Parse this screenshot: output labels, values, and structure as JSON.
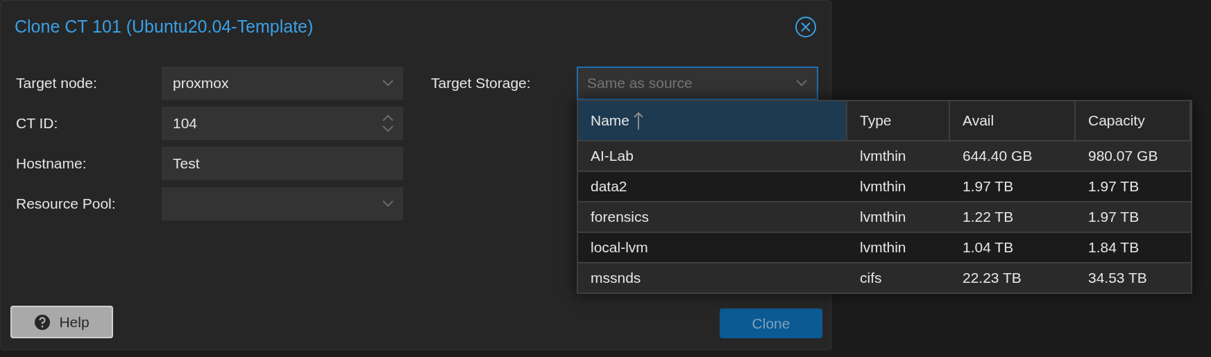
{
  "dialog": {
    "title": "Clone CT 101 (Ubuntu20.04-Template)"
  },
  "fields": [
    {
      "label": "Target node:",
      "kind": "combo",
      "value": "proxmox"
    },
    {
      "label": "CT ID:",
      "kind": "spinner",
      "value": "104"
    },
    {
      "label": "Hostname:",
      "kind": "text",
      "value": "Test"
    },
    {
      "label": "Resource Pool:",
      "kind": "combo"
    }
  ],
  "target_storage": {
    "label": "Target Storage:",
    "placeholder": "Same as source",
    "focused": true,
    "dropdown": {
      "columns": [
        {
          "label": "Name",
          "sorted": true
        },
        {
          "label": "Type",
          "sorted": false
        },
        {
          "label": "Avail",
          "sorted": false
        },
        {
          "label": "Capacity",
          "sorted": false
        }
      ],
      "rows": [
        [
          "AI-Lab",
          "lvmthin",
          "644.40 GB",
          "980.07 GB"
        ],
        [
          "data2",
          "lvmthin",
          "1.97 TB",
          "1.97 TB"
        ],
        [
          "forensics",
          "lvmthin",
          "1.22 TB",
          "1.97 TB"
        ],
        [
          "local-lvm",
          "lvmthin",
          "1.04 TB",
          "1.84 TB"
        ],
        [
          "mssnds",
          "cifs",
          "22.23 TB",
          "34.53 TB"
        ]
      ]
    }
  },
  "buttons": {
    "help": "Help",
    "clone": {
      "label": "Clone",
      "disabled": true
    }
  }
}
